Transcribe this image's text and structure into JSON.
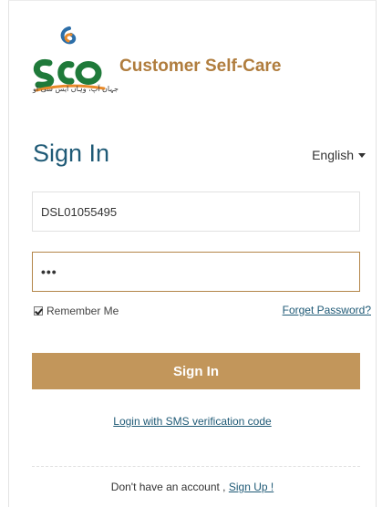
{
  "header": {
    "app_title": "Customer Self-Care",
    "logo_text": "sco",
    "logo_tagline": "جہاں آپ، وہاں ایس سی او"
  },
  "signin": {
    "title": "Sign In",
    "language": "English"
  },
  "form": {
    "username_value": "DSL01055495",
    "password_value": "•••",
    "remember_label": "Remember Me",
    "remember_checked": true,
    "forgot_label": "Forget Password?",
    "submit_label": "Sign In",
    "sms_login_label": "Login with SMS verification code"
  },
  "footer": {
    "no_account_text": "Don't have an account ,",
    "signup_label": "Sign Up !"
  },
  "colors": {
    "brand_gold": "#c2965b",
    "title_gold": "#b07d3e",
    "heading_blue": "#1f5a76",
    "logo_green": "#1f7a3a",
    "logo_orange": "#e98a2a",
    "logo_blue": "#2c6ea8"
  }
}
